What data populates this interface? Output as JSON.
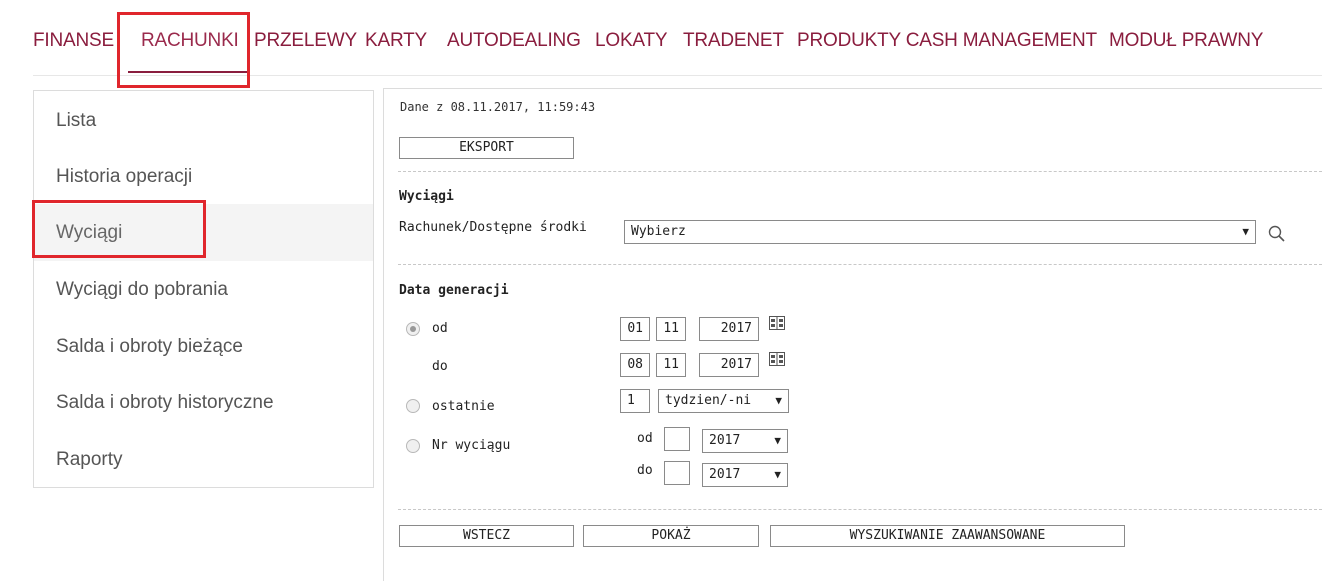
{
  "topnav": {
    "items": [
      "FINANSE",
      "RACHUNKI",
      "PRZELEWY",
      "KARTY",
      "AUTODEALING",
      "LOKATY",
      "TRADENET",
      "PRODUKTY CASH MANAGEMENT",
      "MODUŁ PRAWNY"
    ],
    "active": "RACHUNKI"
  },
  "sidebar": {
    "items": [
      "Lista",
      "Historia operacji",
      "Wyciągi",
      "Wyciągi do pobrania",
      "Salda i obroty bieżące",
      "Salda i obroty historyczne",
      "Raporty"
    ],
    "selected": "Wyciągi"
  },
  "main": {
    "timestamp": "Dane z 08.11.2017, 11:59:43",
    "export_label": "EKSPORT",
    "statements_heading": "Wyciągi",
    "account_label": "Rachunek/Dostępne środki",
    "account_select_value": "Wybierz",
    "generation_heading": "Data generacji",
    "from_label": "od",
    "from_day": "01",
    "from_month": "11",
    "from_year": "2017",
    "to_label": "do",
    "to_day": "08",
    "to_month": "11",
    "to_year": "2017",
    "last_label": "ostatnie",
    "last_count": "1",
    "last_unit": "tydzien/-ni",
    "statement_no_label": "Nr wyciągu",
    "stmt_from_label": "od",
    "stmt_from_number": "",
    "stmt_from_year": "2017",
    "stmt_to_label": "do",
    "stmt_to_number": "",
    "stmt_to_year": "2017",
    "back_label": "WSTECZ",
    "show_label": "POKAŻ",
    "advanced_label": "WYSZUKIWANIE ZAAWANSOWANE",
    "date_mode": "od"
  },
  "colors": {
    "brand": "#8a1d3e",
    "highlight": "#e0262c"
  }
}
